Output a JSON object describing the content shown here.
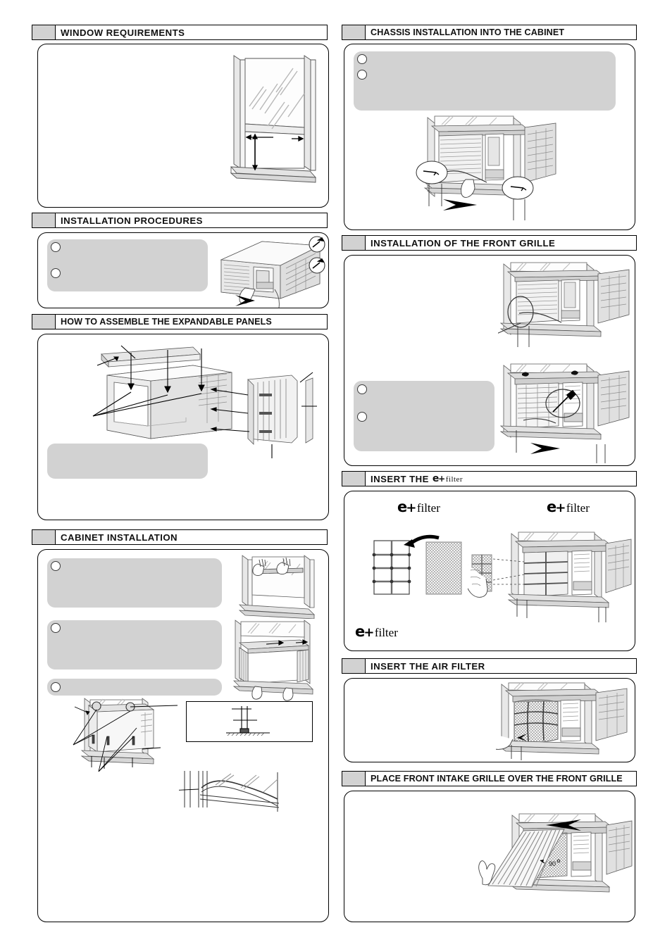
{
  "document": {
    "type": "window-air-conditioner-installation-instructions",
    "page_layout": "two-column",
    "accent_gray": "#d2d2d2",
    "line_color": "#000000"
  },
  "left_column": {
    "sections": [
      {
        "id": "window-requirements",
        "number_label": "",
        "title": "WINDOW REQUIREMENTS",
        "placeholders": [],
        "bullets": 0,
        "illustration": "window-frame-dimension-diagram"
      },
      {
        "id": "installation-procedures",
        "number_label": "",
        "title": "INSTALLATION PROCEDURES",
        "placeholders": [
          {
            "bullet": true
          },
          {
            "bullet": true
          }
        ],
        "bullets": 2,
        "illustration": "chassis-pulled-from-cabinet-with-screw-callouts"
      },
      {
        "id": "how-to-assemble-the-expandable-panels",
        "number_label": "",
        "title": "HOW TO ASSEMBLE THE EXPANDABLE PANELS",
        "placeholders": [
          {
            "bullet": false
          }
        ],
        "bullets": 0,
        "illustration": "exploded-view-cabinet-top-rail-and-side-panels"
      },
      {
        "id": "cabinet-installation",
        "number_label": "",
        "title": "CABINET INSTALLATION",
        "placeholders": [
          {
            "bullet": true
          },
          {
            "bullet": true
          },
          {
            "bullet": true
          }
        ],
        "bullets": 3,
        "illustration": "cabinet-into-window-sill-sequence-with-detail-inset"
      }
    ]
  },
  "right_column": {
    "sections": [
      {
        "id": "chassis-installation-into-the-cabinet",
        "number_label": "",
        "title": "CHASSIS INSTALLATION INTO THE CABINET",
        "placeholders": [
          {
            "bullet": true
          },
          {
            "bullet": true
          }
        ],
        "bullets": 2,
        "illustration": "chassis-sliding-into-mounted-cabinet-with-screw-circles"
      },
      {
        "id": "installation-of-the-front-grille",
        "number_label": "",
        "title": "INSTALLATION OF THE FRONT GRILLE",
        "placeholders": [
          {
            "bullet": true
          },
          {
            "bullet": true
          }
        ],
        "bullets": 2,
        "illustration": "front-grille-attachment-two-views"
      },
      {
        "id": "insert-the-e-filter",
        "number_label": "",
        "title_prefix": "INSERT THE",
        "title_logo": "e+filter",
        "logo_parts": {
          "e": "e",
          "plus": "+",
          "word": "filter"
        },
        "labels": [
          "e+filter",
          "e+filter",
          "e+filter"
        ],
        "illustration": "e-filter-insert-into-front-grille"
      },
      {
        "id": "insert-the-air-filter",
        "number_label": "",
        "title": "INSERT THE AIR FILTER",
        "placeholders": [],
        "bullets": 0,
        "illustration": "air-filter-insert-into-front-grille"
      },
      {
        "id": "place-front-intake-grille-over-the-front-grille",
        "number_label": "",
        "title": "PLACE FRONT INTAKE GRILLE OVER THE FRONT GRILLE",
        "placeholders": [],
        "bullets": 0,
        "annotation": "90",
        "illustration": "front-intake-grille-swing-closed-90-degrees"
      }
    ]
  }
}
